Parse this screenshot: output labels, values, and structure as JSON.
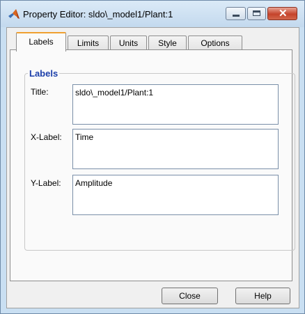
{
  "window": {
    "title": "Property Editor: sldo\\_model1/Plant:1"
  },
  "tabs": [
    {
      "label": "Labels",
      "active": true
    },
    {
      "label": "Limits",
      "active": false
    },
    {
      "label": "Units",
      "active": false
    },
    {
      "label": "Style",
      "active": false
    },
    {
      "label": "Options",
      "active": false
    }
  ],
  "labels_group": {
    "title": "Labels",
    "title_label": "Title:",
    "title_value": "sldo\\_model1/Plant:1",
    "xlabel_label": "X-Label:",
    "xlabel_value": "Time",
    "ylabel_label": "Y-Label:",
    "ylabel_value": "Amplitude"
  },
  "buttons": {
    "close": "Close",
    "help": "Help"
  },
  "colors": {
    "group_title": "#1c3faa",
    "active_tab_accent": "#f0a030",
    "close_button": "#c5432b"
  }
}
